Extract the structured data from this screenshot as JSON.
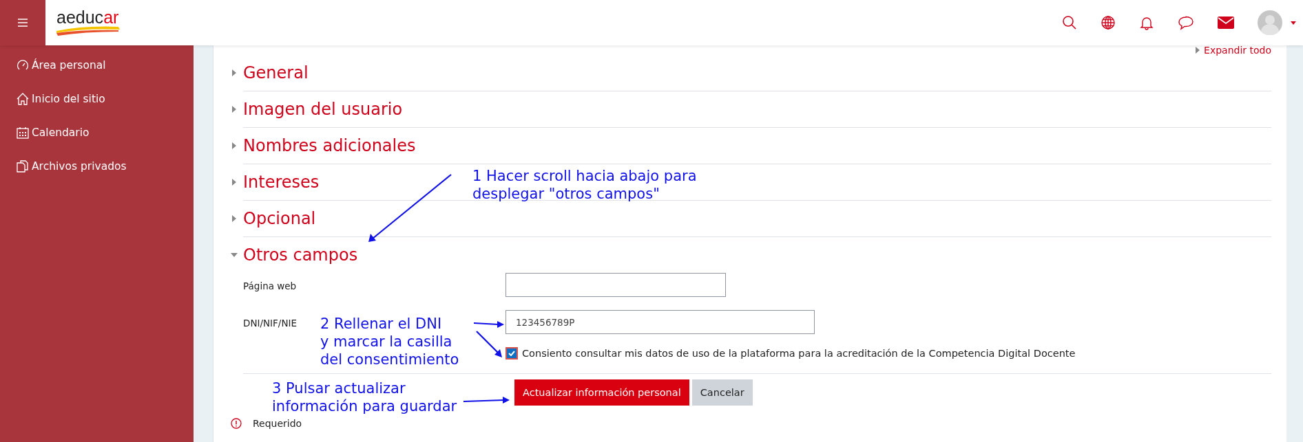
{
  "header": {
    "logo": [
      {
        "text": "aeduc",
        "accent": false
      },
      {
        "text": "ar",
        "accent": true
      }
    ]
  },
  "sidebar": {
    "items": [
      {
        "label": "Área personal"
      },
      {
        "label": "Inicio del sitio"
      },
      {
        "label": "Calendario"
      },
      {
        "label": "Archivos privados"
      }
    ]
  },
  "expand_all": "Expandir todo",
  "sections": [
    {
      "title": "General",
      "expanded": false
    },
    {
      "title": "Imagen del usuario",
      "expanded": false
    },
    {
      "title": "Nombres adicionales",
      "expanded": false
    },
    {
      "title": "Intereses",
      "expanded": false
    },
    {
      "title": "Opcional",
      "expanded": false
    },
    {
      "title": "Otros campos",
      "expanded": true
    }
  ],
  "fields": [
    {
      "label": "Página web"
    },
    {
      "label": "DNI/NIF/NIE",
      "value": "123456789P"
    }
  ],
  "consent": {
    "label": "Consiento consultar mis datos de uso de la plataforma para la acreditación de la Competencia Digital Docente",
    "checked": true
  },
  "buttons": [
    {
      "label": "Actualizar información personal",
      "kind": "primary"
    },
    {
      "label": "Cancelar",
      "kind": "secondary"
    }
  ],
  "required_note": "Requerido",
  "annotations": [
    {
      "lines": [
        "1 Hacer scroll hacia abajo para",
        "desplegar \"otros campos\""
      ]
    },
    {
      "lines": [
        "2 Rellenar el DNI",
        "y marcar la casilla",
        "del consentimiento"
      ]
    },
    {
      "lines": [
        "3 Pulsar actualizar",
        "información para guardar"
      ]
    }
  ]
}
